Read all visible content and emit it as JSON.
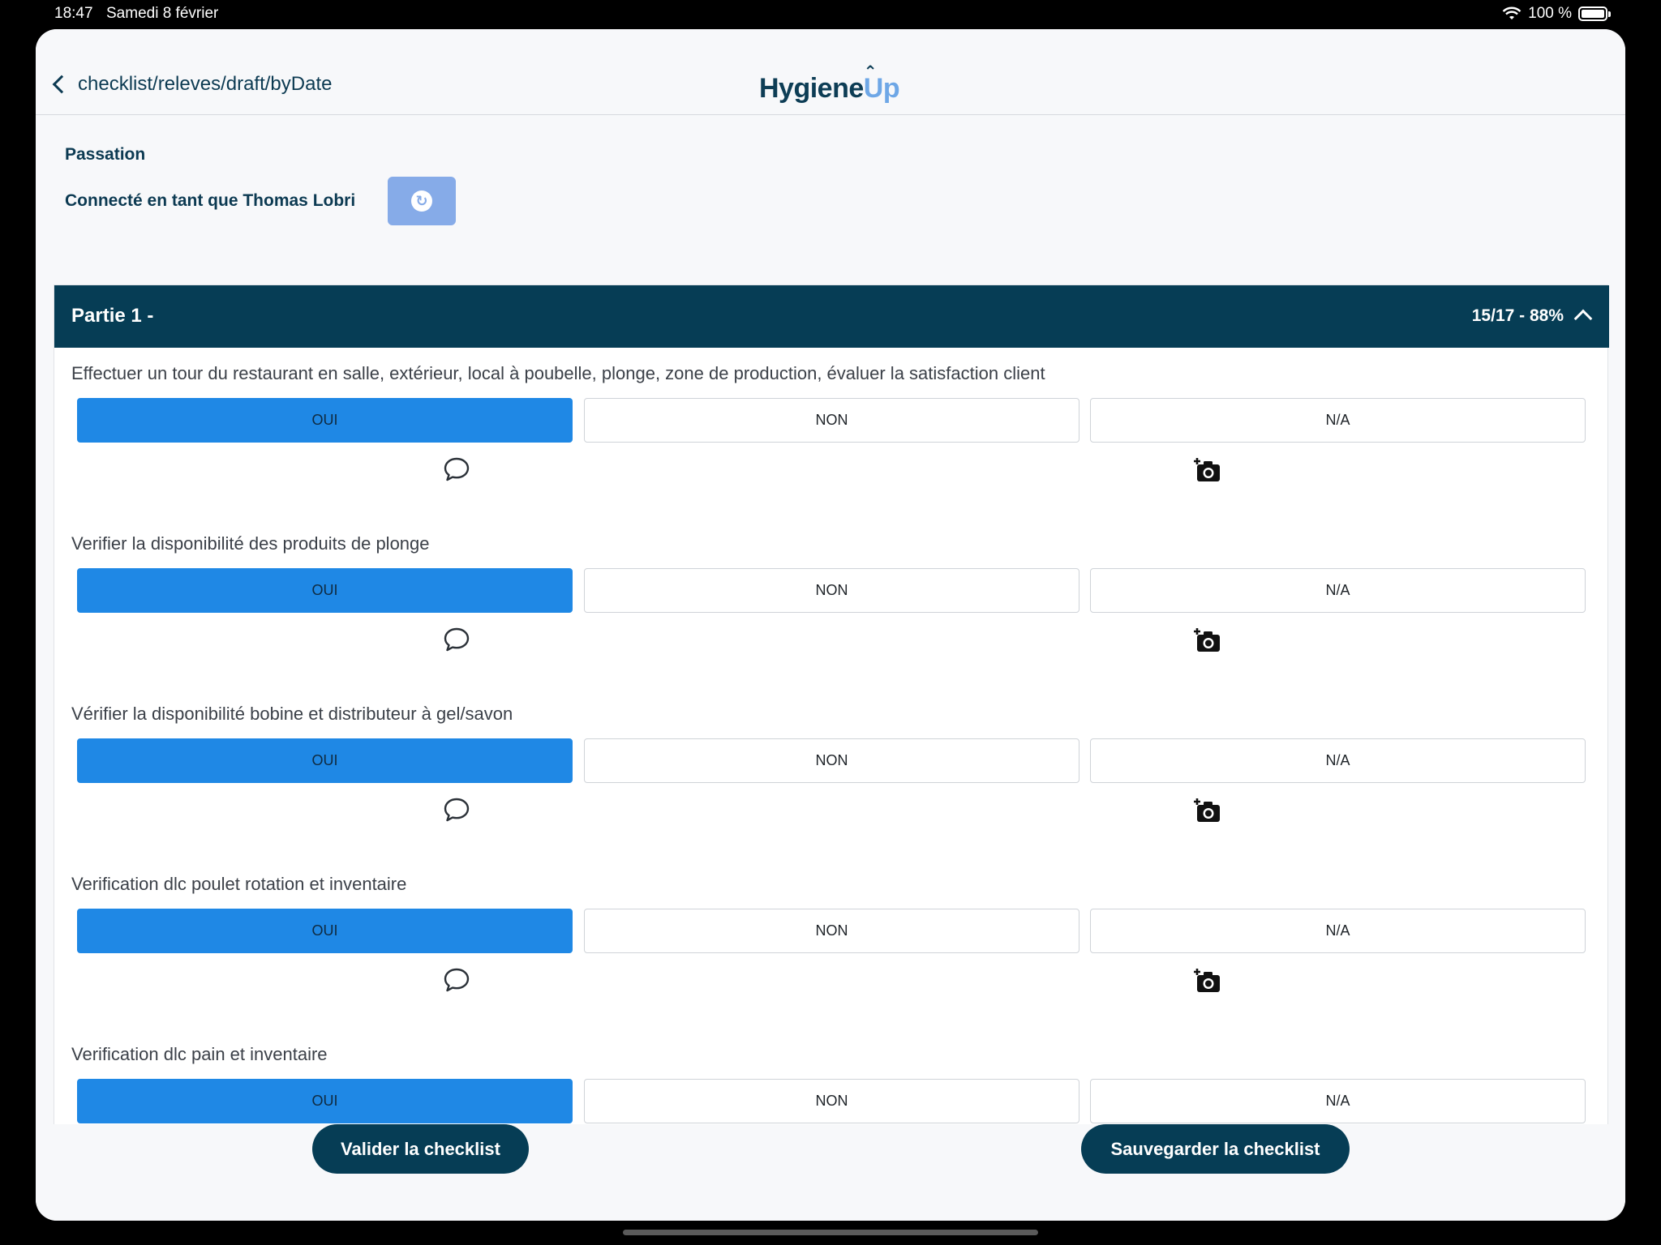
{
  "status_bar": {
    "time": "18:47",
    "date": "Samedi 8 février",
    "battery": "100 %"
  },
  "nav": {
    "back_label": "checklist/releves/draft/byDate",
    "logo_main": "Hygiene",
    "logo_accent": "Up"
  },
  "header": {
    "section_label": "Passation",
    "connected_as": "Connecté en tant que Thomas Lobri"
  },
  "card": {
    "title": "Partie 1 -",
    "progress": "15/17 - 88%"
  },
  "questions": [
    {
      "label": "Effectuer un tour du restaurant en salle, extérieur, local à poubelle, plonge, zone de production, évaluer la satisfaction client",
      "opt_yes": "OUI",
      "opt_no": "NON",
      "opt_na": "N/A",
      "selected": "OUI"
    },
    {
      "label": "Verifier la disponibilité des produits de plonge",
      "opt_yes": "OUI",
      "opt_no": "NON",
      "opt_na": "N/A",
      "selected": "OUI"
    },
    {
      "label": "Vérifier la disponibilité bobine et distributeur à gel/savon",
      "opt_yes": "OUI",
      "opt_no": "NON",
      "opt_na": "N/A",
      "selected": "OUI"
    },
    {
      "label": "Verification dlc poulet rotation et inventaire",
      "opt_yes": "OUI",
      "opt_no": "NON",
      "opt_na": "N/A",
      "selected": "OUI"
    },
    {
      "label": "Verification dlc pain et inventaire",
      "opt_yes": "OUI",
      "opt_no": "NON",
      "opt_na": "N/A",
      "selected": "OUI"
    }
  ],
  "footer": {
    "validate_label": "Valider la checklist",
    "save_label": "Sauvegarder la checklist"
  },
  "icons": {
    "back": "chevron-left-icon",
    "refresh": "refresh-icon",
    "collapse": "chevron-up-icon",
    "comment": "comment-icon",
    "camera": "add-photo-icon"
  },
  "colors": {
    "primary_dark": "#063d55",
    "selected_blue": "#1f88e5",
    "refresh_bg": "#86abe8"
  }
}
